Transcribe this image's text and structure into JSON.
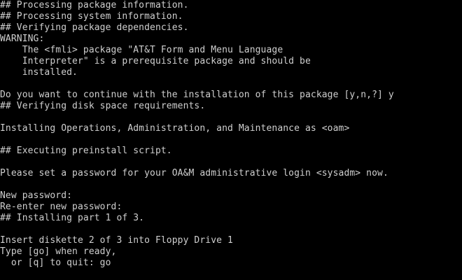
{
  "terminal": {
    "lines": [
      "## Processing package information.",
      "## Processing system information.",
      "## Verifying package dependencies.",
      "WARNING:",
      "    The <fmli> package \"AT&T Form and Menu Language",
      "    Interpreter\" is a prerequisite package and should be",
      "    installed.",
      "",
      "Do you want to continue with the installation of this package [y,n,?] y",
      "## Verifying disk space requirements.",
      "",
      "Installing Operations, Administration, and Maintenance as <oam>",
      "",
      "## Executing preinstall script.",
      "",
      "Please set a password for your OA&M administrative login <sysadm> now.",
      "",
      "New password:",
      "Re-enter new password:",
      "## Installing part 1 of 3.",
      "",
      "Insert diskette 2 of 3 into Floppy Drive 1",
      "Type [go] when ready,",
      "  or [q] to quit: go"
    ]
  },
  "colors": {
    "background": "#000000",
    "text": "#cfcfcf"
  }
}
